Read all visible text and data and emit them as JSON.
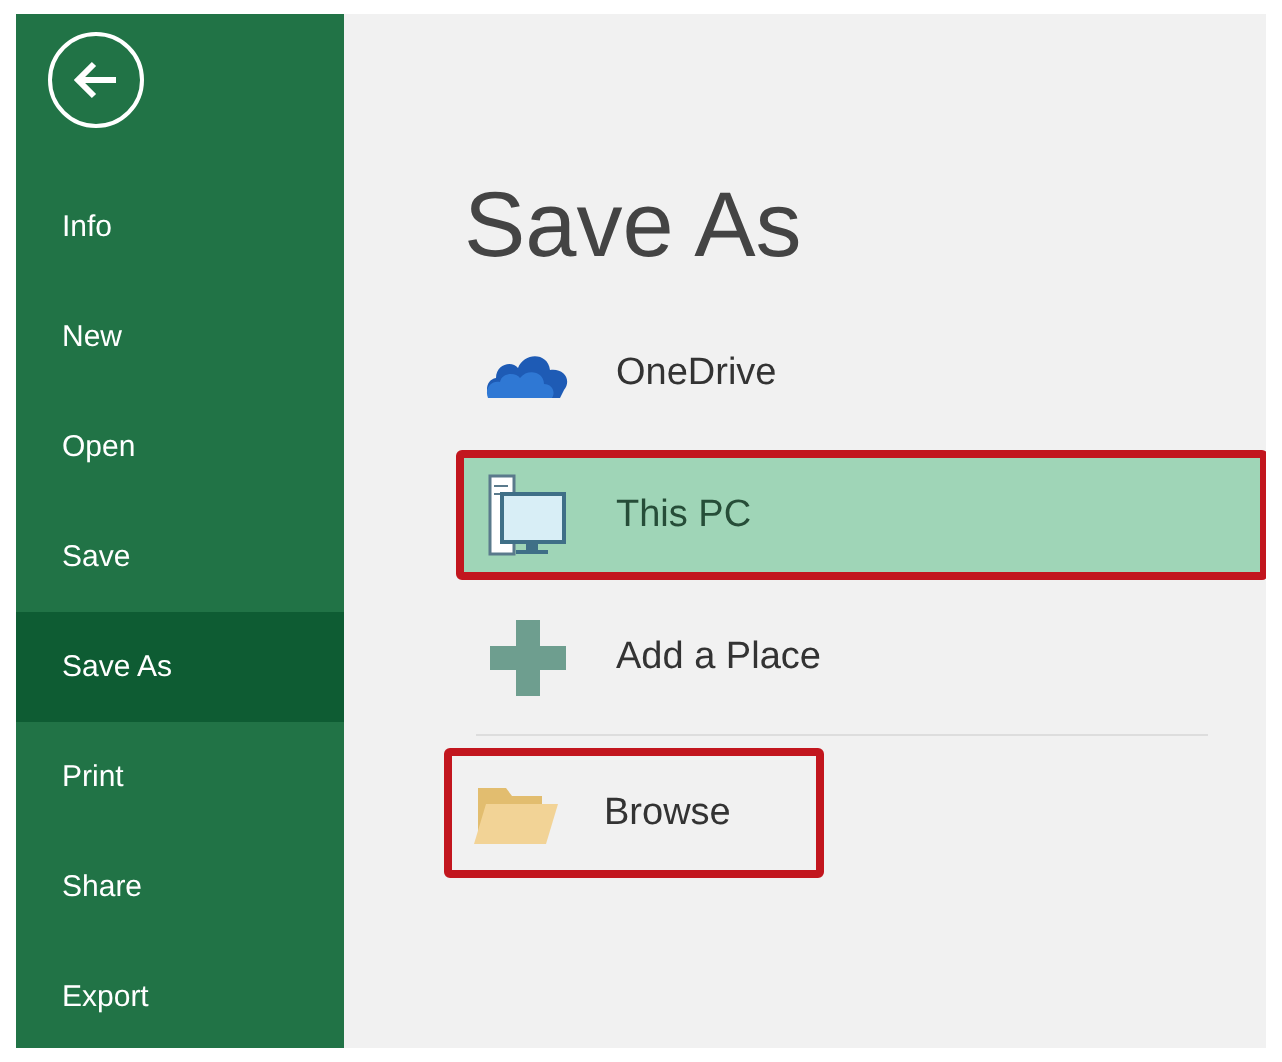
{
  "sidebar": {
    "items": [
      {
        "label": "Info",
        "selected": false
      },
      {
        "label": "New",
        "selected": false
      },
      {
        "label": "Open",
        "selected": false
      },
      {
        "label": "Save",
        "selected": false
      },
      {
        "label": "Save As",
        "selected": true
      },
      {
        "label": "Print",
        "selected": false
      },
      {
        "label": "Share",
        "selected": false
      },
      {
        "label": "Export",
        "selected": false
      }
    ]
  },
  "page_title": "Save As",
  "places": [
    {
      "kind": "cloud",
      "label": "OneDrive",
      "selected": false,
      "highlighted": false
    },
    {
      "kind": "computer",
      "label": "This PC",
      "selected": true,
      "highlighted": true
    },
    {
      "kind": "add",
      "label": "Add a Place",
      "selected": false,
      "highlighted": false
    },
    {
      "kind": "folder",
      "label": "Browse",
      "selected": false,
      "highlighted": true
    }
  ]
}
